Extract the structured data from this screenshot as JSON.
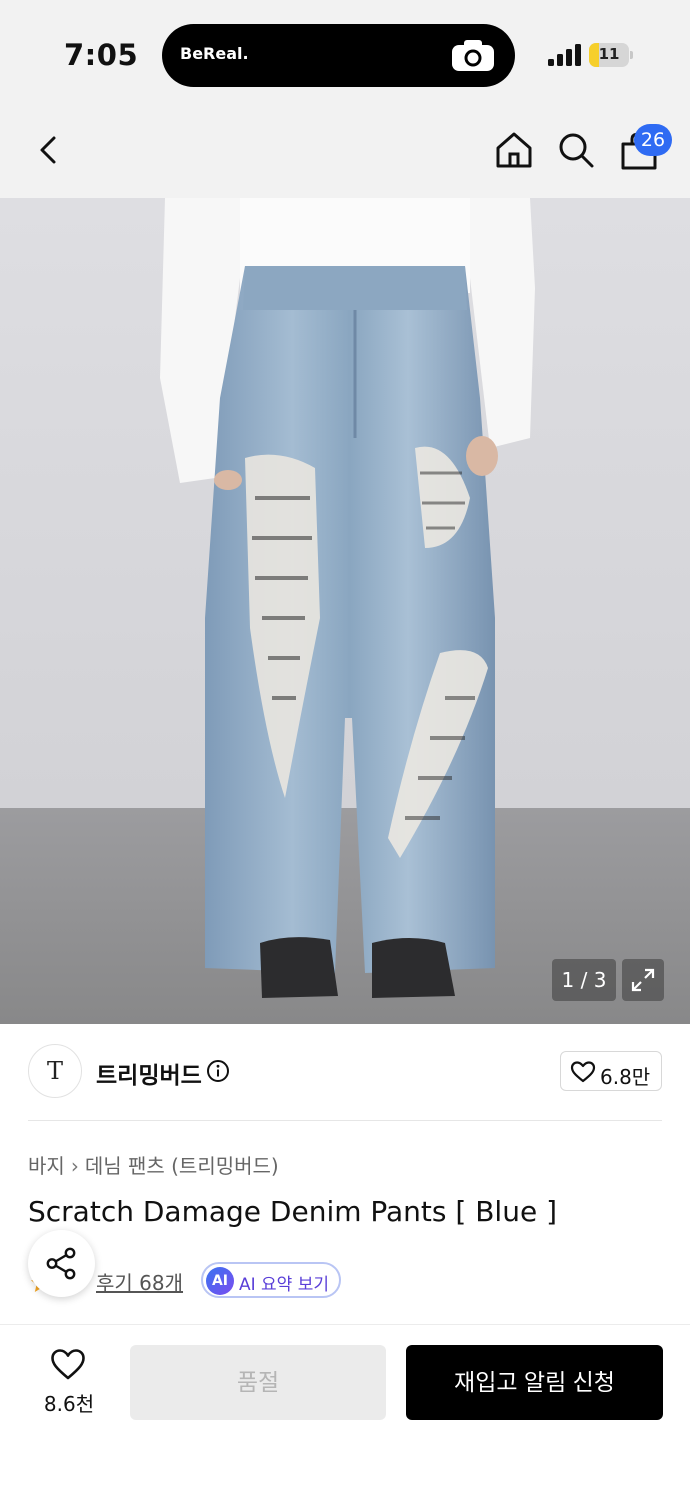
{
  "status_bar": {
    "time": "7:05",
    "notification_label": "BeReal.",
    "notification_icon": "camera-icon",
    "signal_icon": "cellular-signal-icon",
    "battery_percent": "11",
    "battery_level": 0.11,
    "battery_color": "#f6cf2b"
  },
  "nav": {
    "back_icon": "chevron-left-icon",
    "home_icon": "home-icon",
    "search_icon": "search-icon",
    "cart_icon": "shopping-bag-icon",
    "cart_count": "26",
    "badge_color": "#2f6bf3"
  },
  "gallery": {
    "counter": "1 / 3",
    "expand_icon": "expand-icon"
  },
  "brand": {
    "logo_text": "T",
    "name": "트리밍버드",
    "info_icon": "info-icon",
    "like_icon": "heart-icon",
    "like_count": "6.8만"
  },
  "product": {
    "breadcrumb": [
      "바지",
      "데님 팬츠 (트리밍버드)"
    ],
    "title": "Scratch Damage Denim Pants [ Blue ]",
    "review_text": "후기 68개",
    "ai_badge": "AI",
    "ai_label": "AI 요약 보기",
    "share_icon": "share-icon",
    "star_color": "#f5a623"
  },
  "bottom_bar": {
    "wish_icon": "heart-outline-icon",
    "wish_count": "8.6천",
    "soldout_label": "품절",
    "restock_label": "재입고 알림 신청"
  }
}
